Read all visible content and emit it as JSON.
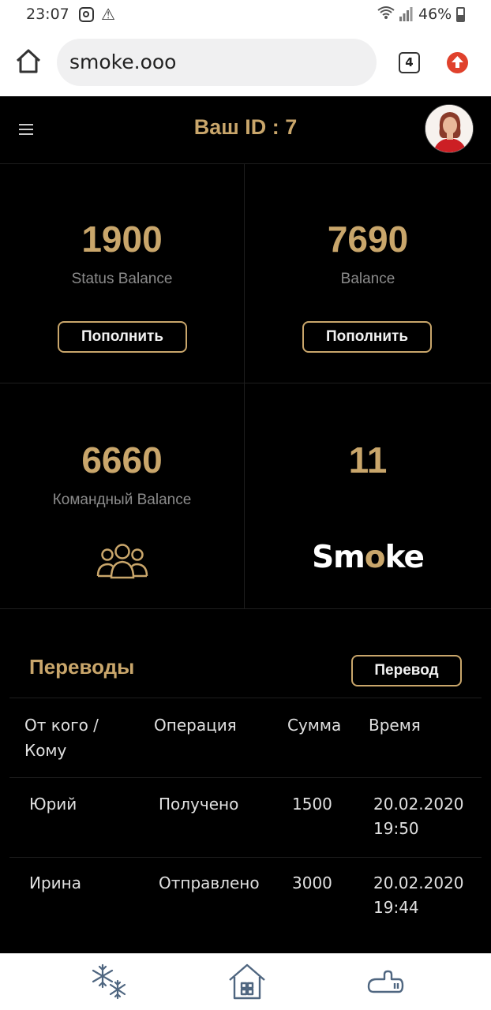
{
  "status_bar": {
    "time": "23:07",
    "battery": "46%",
    "icons": [
      "instagram-icon",
      "warning-icon",
      "wifi-icon",
      "signal-icon",
      "battery-icon"
    ]
  },
  "browser": {
    "url": "smoke.ooo",
    "tab_count": "4"
  },
  "header": {
    "title": "Ваш ID : 7"
  },
  "cards": [
    {
      "value": "1900",
      "label": "Status Balance",
      "button": "Пополнить"
    },
    {
      "value": "7690",
      "label": "Balance",
      "button": "Пополнить"
    },
    {
      "value": "6660",
      "label": "Командный Balance",
      "icon": "team-icon"
    },
    {
      "value": "11",
      "logo": "Smoke"
    }
  ],
  "transfers": {
    "title": "Переводы",
    "button": "Перевод",
    "columns": [
      "От кого /",
      "Кому",
      "Операция",
      "Сумма",
      "Время"
    ],
    "rows": [
      {
        "from_to": "Юрий",
        "operation": "Получено",
        "amount": "1500",
        "date": "20.02.2020",
        "time": "19:50"
      },
      {
        "from_to": "Ирина",
        "operation": "Отправлено",
        "amount": "3000",
        "date": "20.02.2020",
        "time": "19:44"
      }
    ]
  },
  "bottom_nav": [
    "snowflake-icon",
    "home-icon",
    "hookah-icon"
  ],
  "colors": {
    "accent": "#c9a66b",
    "background": "#000000",
    "muted_text": "#8b8b8b",
    "update_badge": "#e0412c"
  }
}
